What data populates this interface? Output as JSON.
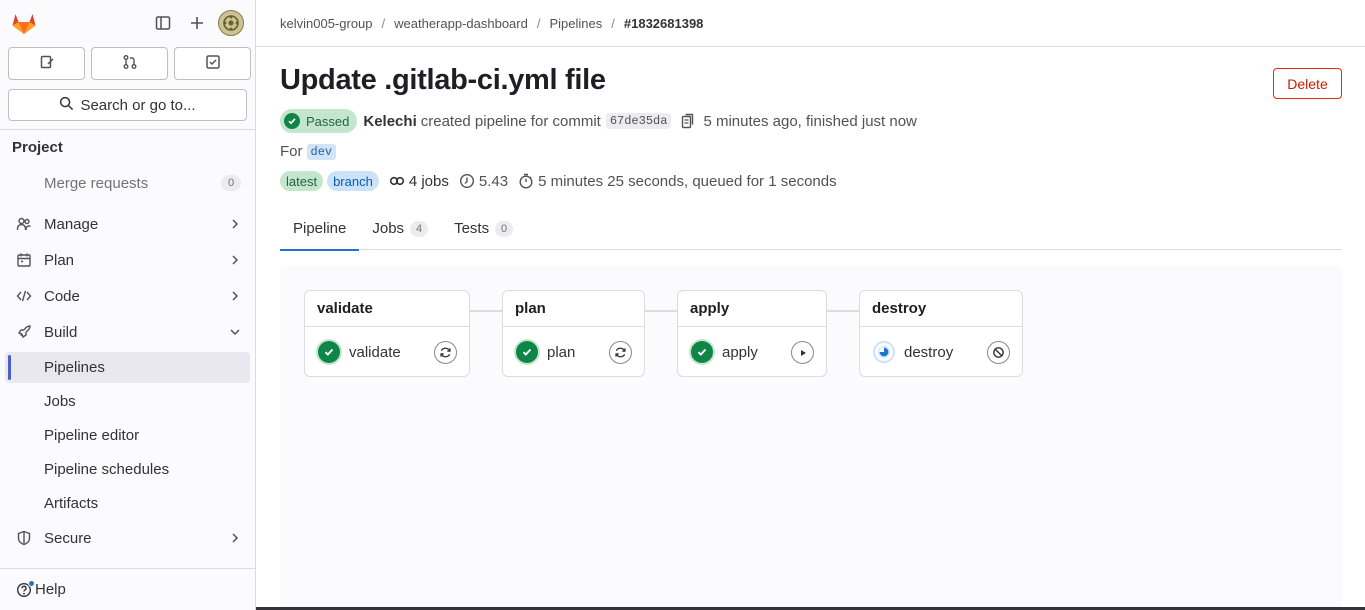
{
  "sidebar": {
    "search_label": "Search or go to...",
    "section_title": "Project",
    "merge_requests": {
      "label": "Merge requests",
      "count": "0"
    },
    "items": [
      {
        "label": "Manage",
        "icon": "users-icon"
      },
      {
        "label": "Plan",
        "icon": "planning-icon"
      },
      {
        "label": "Code",
        "icon": "code-icon"
      },
      {
        "label": "Build",
        "icon": "rocket-icon"
      }
    ],
    "build_children": [
      {
        "label": "Pipelines",
        "active": true
      },
      {
        "label": "Jobs"
      },
      {
        "label": "Pipeline editor"
      },
      {
        "label": "Pipeline schedules"
      },
      {
        "label": "Artifacts"
      }
    ],
    "secure": {
      "label": "Secure",
      "icon": "shield-icon"
    },
    "help_label": "Help"
  },
  "breadcrumb": {
    "group": "kelvin005-group",
    "project": "weatherapp-dashboard",
    "section": "Pipelines",
    "current": "#1832681398"
  },
  "pipeline": {
    "title": "Update .gitlab-ci.yml file",
    "delete_label": "Delete",
    "status": "Passed",
    "author": "Kelechi",
    "created_text": "created pipeline for commit",
    "sha": "67de35da",
    "time_text": "5 minutes ago, finished just now",
    "for_label": "For",
    "ref": "dev",
    "badge_latest": "latest",
    "badge_branch": "branch",
    "jobs_text": "4 jobs",
    "compute": "5.43",
    "duration_text": "5 minutes 25 seconds, queued for 1 seconds"
  },
  "tabs": [
    {
      "label": "Pipeline",
      "count": null
    },
    {
      "label": "Jobs",
      "count": "4"
    },
    {
      "label": "Tests",
      "count": "0"
    }
  ],
  "stages": [
    {
      "name": "validate",
      "job": "validate",
      "status": "success",
      "action": "retry-icon"
    },
    {
      "name": "plan",
      "job": "plan",
      "status": "success",
      "action": "retry-icon"
    },
    {
      "name": "apply",
      "job": "apply",
      "status": "success",
      "action": "play-icon"
    },
    {
      "name": "destroy",
      "job": "destroy",
      "status": "running",
      "action": "cancel-icon"
    }
  ],
  "colors": {
    "accent": "#1f75cb",
    "success": "#108548",
    "danger": "#dd2b0e"
  }
}
